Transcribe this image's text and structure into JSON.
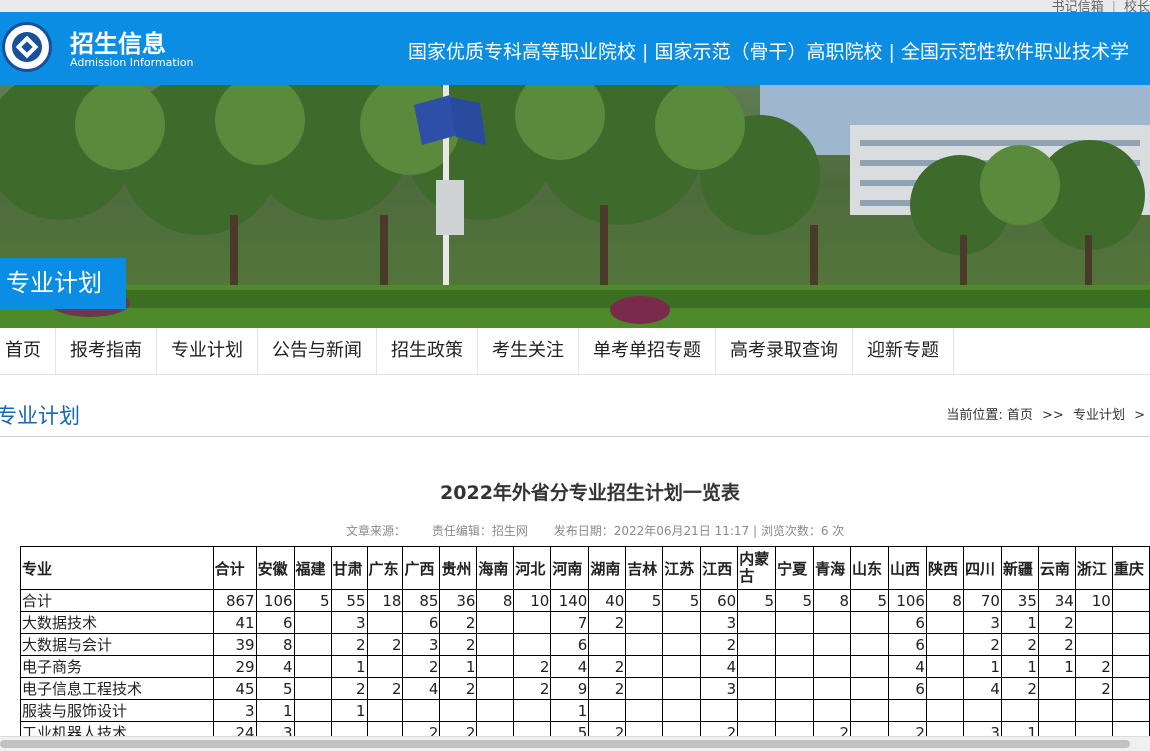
{
  "top_links": [
    "书记信箱",
    "校长"
  ],
  "header": {
    "title": "招生信息",
    "subtitle": "Admission Information",
    "slogan": "国家优质专科高等职业院校 | 国家示范（骨干）高职院校 | 全国示范性软件职业技术学"
  },
  "banner": {
    "label": "专业计划"
  },
  "nav": {
    "items": [
      "首页",
      "报考指南",
      "专业计划",
      "公告与新闻",
      "招生政策",
      "考生关注",
      "单考单招专题",
      "高考录取查询",
      "迎新专题"
    ]
  },
  "section": {
    "title": "专业计划",
    "breadcrumb_prefix": "当前位置:",
    "breadcrumb_home": "首页",
    "breadcrumb_sep": ">>",
    "breadcrumb_current": "专业计划",
    "breadcrumb_tail": ">"
  },
  "article": {
    "title": "2022年外省分专业招生计划一览表",
    "source": "文章来源：",
    "editor": "责任编辑：招生网",
    "date": "发布日期：2022年06月21日 11:17 | 浏览次数：6 次"
  },
  "table": {
    "headers": [
      "专业",
      "合计",
      "安徽",
      "福建",
      "甘肃",
      "广东",
      "广西",
      "贵州",
      "海南",
      "河北",
      "河南",
      "湖南",
      "吉林",
      "江苏",
      "江西",
      "内蒙古",
      "宁夏",
      "青海",
      "山东",
      "山西",
      "陕西",
      "四川",
      "新疆",
      "云南",
      "浙江",
      "重庆"
    ],
    "rows": [
      [
        "合计",
        "867",
        "106",
        "5",
        "55",
        "18",
        "85",
        "36",
        "8",
        "10",
        "140",
        "40",
        "5",
        "5",
        "60",
        "5",
        "5",
        "8",
        "5",
        "106",
        "8",
        "70",
        "35",
        "34",
        "10",
        ""
      ],
      [
        "大数据技术",
        "41",
        "6",
        "",
        "3",
        "",
        "6",
        "2",
        "",
        "",
        "7",
        "2",
        "",
        "",
        "3",
        "",
        "",
        "",
        "",
        "6",
        "",
        "3",
        "1",
        "2",
        "",
        ""
      ],
      [
        "大数据与会计",
        "39",
        "8",
        "",
        "2",
        "2",
        "3",
        "2",
        "",
        "",
        "6",
        "",
        "",
        "",
        "2",
        "",
        "",
        "",
        "",
        "6",
        "",
        "2",
        "2",
        "2",
        "",
        ""
      ],
      [
        "电子商务",
        "29",
        "4",
        "",
        "1",
        "",
        "2",
        "1",
        "",
        "2",
        "4",
        "2",
        "",
        "",
        "4",
        "",
        "",
        "",
        "",
        "4",
        "",
        "1",
        "1",
        "1",
        "2",
        ""
      ],
      [
        "电子信息工程技术",
        "45",
        "5",
        "",
        "2",
        "2",
        "4",
        "2",
        "",
        "2",
        "9",
        "2",
        "",
        "",
        "3",
        "",
        "",
        "",
        "",
        "6",
        "",
        "4",
        "2",
        "",
        "2",
        ""
      ],
      [
        "服装与服饰设计",
        "3",
        "1",
        "",
        "1",
        "",
        "",
        "",
        "",
        "",
        "1",
        "",
        "",
        "",
        "",
        "",
        "",
        "",
        "",
        "",
        "",
        "",
        "",
        "",
        "",
        ""
      ],
      [
        "工业机器人技术",
        "24",
        "3",
        "",
        "",
        "",
        "2",
        "2",
        "",
        "",
        "5",
        "2",
        "",
        "",
        "2",
        "",
        "",
        "2",
        "",
        "2",
        "",
        "3",
        "1",
        "",
        "",
        ""
      ]
    ]
  },
  "colors": {
    "header_blue": "#0a8de3",
    "section_title": "#1767b3"
  }
}
